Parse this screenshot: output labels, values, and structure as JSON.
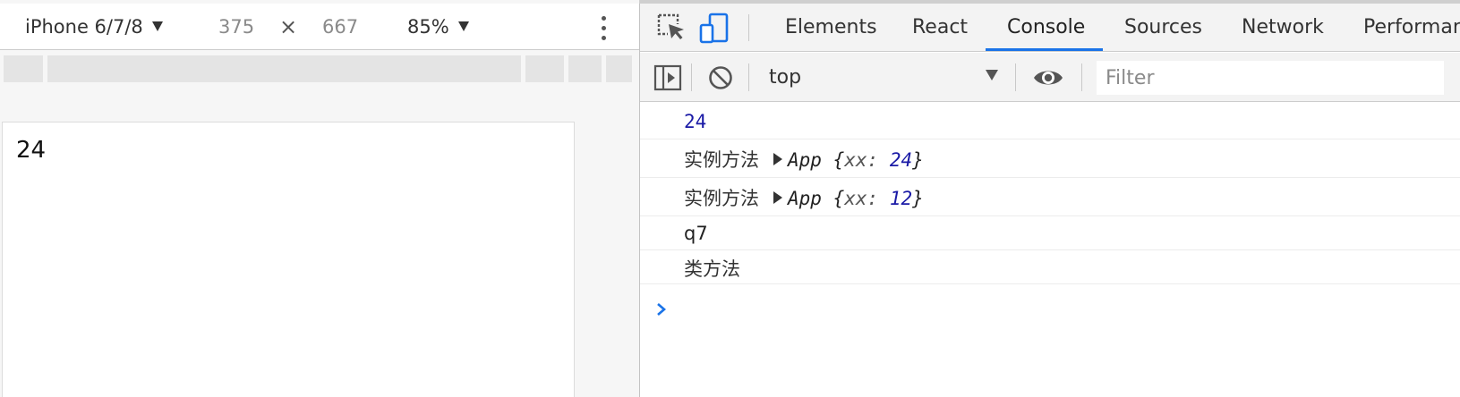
{
  "device_toolbar": {
    "device": "iPhone 6/7/8",
    "width": "375",
    "times": "×",
    "height": "667",
    "zoom": "85%"
  },
  "viewport": {
    "text": "24"
  },
  "tabs": [
    {
      "label": "Elements"
    },
    {
      "label": "React"
    },
    {
      "label": "Console",
      "active": true
    },
    {
      "label": "Sources"
    },
    {
      "label": "Network"
    },
    {
      "label": "Performan"
    }
  ],
  "console_toolbar": {
    "context": "top",
    "filter_placeholder": "Filter"
  },
  "console": {
    "rows": [
      {
        "value": "24"
      },
      {
        "label": "实例方法",
        "class": "App",
        "open": "{",
        "key": "xx",
        "value": "24",
        "close": "}"
      },
      {
        "label": "实例方法",
        "class": "App",
        "open": "{",
        "key": "xx",
        "value": "12",
        "close": "}"
      },
      {
        "text": "q7"
      },
      {
        "text": "类方法"
      }
    ]
  },
  "icons": {
    "inspect": "inspect-element-icon",
    "device": "device-toggle-icon",
    "sidebar": "console-sidebar-icon",
    "clear": "clear-console-icon",
    "eye": "live-expression-eye-icon",
    "prompt": "console-prompt-chevron-icon",
    "more": "more-vertical-icon"
  },
  "colors": {
    "accent": "#1a73e8",
    "number": "#1a1aa6"
  }
}
